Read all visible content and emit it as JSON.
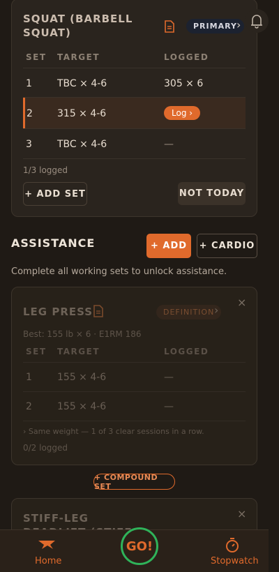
{
  "bell_icon": "bell-icon",
  "exercise1": {
    "title_line1": "SQUAT (BARBELL",
    "title_line2": "SQUAT)",
    "badge": "PRIMARY",
    "headers": {
      "set": "SET",
      "target": "TARGET",
      "logged": "LOGGED"
    },
    "rows": [
      {
        "set": "1",
        "target": "TBC × 4-6",
        "logged": "305 × 6"
      },
      {
        "set": "2",
        "target": "315 × 4-6",
        "logged": "Log ›"
      },
      {
        "set": "3",
        "target": "TBC × 4-6",
        "logged": "—"
      }
    ],
    "progress": "1/3 logged",
    "add_set": "+ ADD SET",
    "not_today": "NOT TODAY"
  },
  "assistance": {
    "title": "ASSISTANCE",
    "add": "+ ADD",
    "cardio": "+ CARDIO",
    "note": "Complete all working sets to unlock assistance."
  },
  "exercise2": {
    "title": "LEG PRESS",
    "badge": "DEFINITION",
    "best": "Best: 155 lb × 6 · E1RM 186",
    "headers": {
      "set": "SET",
      "target": "TARGET",
      "logged": "LOGGED"
    },
    "rows": [
      {
        "set": "1",
        "target": "155 × 4-6",
        "logged": "—"
      },
      {
        "set": "2",
        "target": "155 × 4-6",
        "logged": "—"
      }
    ],
    "hint": "›  Same weight — 1 of 3 clear sessions in a row.",
    "progress": "0/2 logged"
  },
  "compound_set": "+ COMPOUND SET",
  "exercise3": {
    "title_line1": "STIFF-LEG",
    "title_line2": "DEADLIFT (STIFF"
  },
  "nav": {
    "home": "Home",
    "go": "GO!",
    "stopwatch": "Stopwatch"
  },
  "colors": {
    "accent": "#e06a2c",
    "go_ring": "#2fb35a",
    "primary_badge_bg": "#1c2230"
  }
}
